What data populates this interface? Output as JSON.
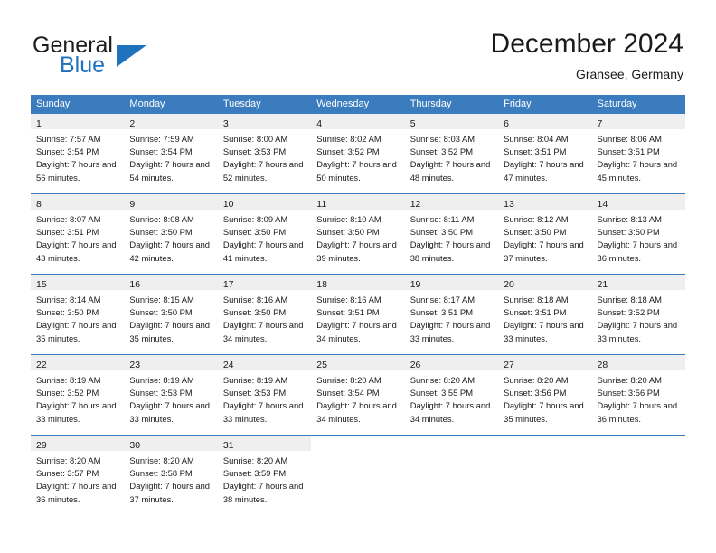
{
  "brand": {
    "name_part1": "General",
    "name_part2": "Blue",
    "flag_icon": "triangle-flag-icon",
    "accent_color": "#1f72bd"
  },
  "header": {
    "title": "December 2024",
    "subtitle": "Gransee, Germany"
  },
  "calendar": {
    "header_bg": "#3a7cbe",
    "daynum_bg": "#efefef",
    "weekday_headers": [
      "Sunday",
      "Monday",
      "Tuesday",
      "Wednesday",
      "Thursday",
      "Friday",
      "Saturday"
    ],
    "weeks": [
      [
        {
          "day": "1",
          "sunrise": "Sunrise: 7:57 AM",
          "sunset": "Sunset: 3:54 PM",
          "daylight": "Daylight: 7 hours and 56 minutes."
        },
        {
          "day": "2",
          "sunrise": "Sunrise: 7:59 AM",
          "sunset": "Sunset: 3:54 PM",
          "daylight": "Daylight: 7 hours and 54 minutes."
        },
        {
          "day": "3",
          "sunrise": "Sunrise: 8:00 AM",
          "sunset": "Sunset: 3:53 PM",
          "daylight": "Daylight: 7 hours and 52 minutes."
        },
        {
          "day": "4",
          "sunrise": "Sunrise: 8:02 AM",
          "sunset": "Sunset: 3:52 PM",
          "daylight": "Daylight: 7 hours and 50 minutes."
        },
        {
          "day": "5",
          "sunrise": "Sunrise: 8:03 AM",
          "sunset": "Sunset: 3:52 PM",
          "daylight": "Daylight: 7 hours and 48 minutes."
        },
        {
          "day": "6",
          "sunrise": "Sunrise: 8:04 AM",
          "sunset": "Sunset: 3:51 PM",
          "daylight": "Daylight: 7 hours and 47 minutes."
        },
        {
          "day": "7",
          "sunrise": "Sunrise: 8:06 AM",
          "sunset": "Sunset: 3:51 PM",
          "daylight": "Daylight: 7 hours and 45 minutes."
        }
      ],
      [
        {
          "day": "8",
          "sunrise": "Sunrise: 8:07 AM",
          "sunset": "Sunset: 3:51 PM",
          "daylight": "Daylight: 7 hours and 43 minutes."
        },
        {
          "day": "9",
          "sunrise": "Sunrise: 8:08 AM",
          "sunset": "Sunset: 3:50 PM",
          "daylight": "Daylight: 7 hours and 42 minutes."
        },
        {
          "day": "10",
          "sunrise": "Sunrise: 8:09 AM",
          "sunset": "Sunset: 3:50 PM",
          "daylight": "Daylight: 7 hours and 41 minutes."
        },
        {
          "day": "11",
          "sunrise": "Sunrise: 8:10 AM",
          "sunset": "Sunset: 3:50 PM",
          "daylight": "Daylight: 7 hours and 39 minutes."
        },
        {
          "day": "12",
          "sunrise": "Sunrise: 8:11 AM",
          "sunset": "Sunset: 3:50 PM",
          "daylight": "Daylight: 7 hours and 38 minutes."
        },
        {
          "day": "13",
          "sunrise": "Sunrise: 8:12 AM",
          "sunset": "Sunset: 3:50 PM",
          "daylight": "Daylight: 7 hours and 37 minutes."
        },
        {
          "day": "14",
          "sunrise": "Sunrise: 8:13 AM",
          "sunset": "Sunset: 3:50 PM",
          "daylight": "Daylight: 7 hours and 36 minutes."
        }
      ],
      [
        {
          "day": "15",
          "sunrise": "Sunrise: 8:14 AM",
          "sunset": "Sunset: 3:50 PM",
          "daylight": "Daylight: 7 hours and 35 minutes."
        },
        {
          "day": "16",
          "sunrise": "Sunrise: 8:15 AM",
          "sunset": "Sunset: 3:50 PM",
          "daylight": "Daylight: 7 hours and 35 minutes."
        },
        {
          "day": "17",
          "sunrise": "Sunrise: 8:16 AM",
          "sunset": "Sunset: 3:50 PM",
          "daylight": "Daylight: 7 hours and 34 minutes."
        },
        {
          "day": "18",
          "sunrise": "Sunrise: 8:16 AM",
          "sunset": "Sunset: 3:51 PM",
          "daylight": "Daylight: 7 hours and 34 minutes."
        },
        {
          "day": "19",
          "sunrise": "Sunrise: 8:17 AM",
          "sunset": "Sunset: 3:51 PM",
          "daylight": "Daylight: 7 hours and 33 minutes."
        },
        {
          "day": "20",
          "sunrise": "Sunrise: 8:18 AM",
          "sunset": "Sunset: 3:51 PM",
          "daylight": "Daylight: 7 hours and 33 minutes."
        },
        {
          "day": "21",
          "sunrise": "Sunrise: 8:18 AM",
          "sunset": "Sunset: 3:52 PM",
          "daylight": "Daylight: 7 hours and 33 minutes."
        }
      ],
      [
        {
          "day": "22",
          "sunrise": "Sunrise: 8:19 AM",
          "sunset": "Sunset: 3:52 PM",
          "daylight": "Daylight: 7 hours and 33 minutes."
        },
        {
          "day": "23",
          "sunrise": "Sunrise: 8:19 AM",
          "sunset": "Sunset: 3:53 PM",
          "daylight": "Daylight: 7 hours and 33 minutes."
        },
        {
          "day": "24",
          "sunrise": "Sunrise: 8:19 AM",
          "sunset": "Sunset: 3:53 PM",
          "daylight": "Daylight: 7 hours and 33 minutes."
        },
        {
          "day": "25",
          "sunrise": "Sunrise: 8:20 AM",
          "sunset": "Sunset: 3:54 PM",
          "daylight": "Daylight: 7 hours and 34 minutes."
        },
        {
          "day": "26",
          "sunrise": "Sunrise: 8:20 AM",
          "sunset": "Sunset: 3:55 PM",
          "daylight": "Daylight: 7 hours and 34 minutes."
        },
        {
          "day": "27",
          "sunrise": "Sunrise: 8:20 AM",
          "sunset": "Sunset: 3:56 PM",
          "daylight": "Daylight: 7 hours and 35 minutes."
        },
        {
          "day": "28",
          "sunrise": "Sunrise: 8:20 AM",
          "sunset": "Sunset: 3:56 PM",
          "daylight": "Daylight: 7 hours and 36 minutes."
        }
      ],
      [
        {
          "day": "29",
          "sunrise": "Sunrise: 8:20 AM",
          "sunset": "Sunset: 3:57 PM",
          "daylight": "Daylight: 7 hours and 36 minutes."
        },
        {
          "day": "30",
          "sunrise": "Sunrise: 8:20 AM",
          "sunset": "Sunset: 3:58 PM",
          "daylight": "Daylight: 7 hours and 37 minutes."
        },
        {
          "day": "31",
          "sunrise": "Sunrise: 8:20 AM",
          "sunset": "Sunset: 3:59 PM",
          "daylight": "Daylight: 7 hours and 38 minutes."
        },
        {
          "day": "",
          "sunrise": "",
          "sunset": "",
          "daylight": ""
        },
        {
          "day": "",
          "sunrise": "",
          "sunset": "",
          "daylight": ""
        },
        {
          "day": "",
          "sunrise": "",
          "sunset": "",
          "daylight": ""
        },
        {
          "day": "",
          "sunrise": "",
          "sunset": "",
          "daylight": ""
        }
      ]
    ]
  }
}
